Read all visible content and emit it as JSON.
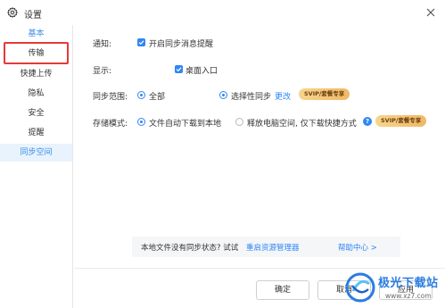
{
  "window": {
    "title": "设置",
    "title_icon": "gear-icon",
    "close_icon": "close-icon"
  },
  "sidebar": {
    "items": [
      {
        "label": "基本"
      },
      {
        "label": "传输"
      },
      {
        "label": "快捷上传"
      },
      {
        "label": "隐私"
      },
      {
        "label": "安全"
      },
      {
        "label": "提醒"
      },
      {
        "label": "同步空间"
      }
    ],
    "active_index": 6,
    "highlight_color": "#e23a3a"
  },
  "settings": {
    "notify": {
      "label": "通知:",
      "option": "开启同步消息提醒",
      "checked": true
    },
    "display": {
      "label": "显示:",
      "option": "桌面入口",
      "checked": true
    },
    "sync_range": {
      "label": "同步范围:",
      "options": [
        "全部",
        "选择性同步"
      ],
      "selected_index": 0,
      "change_link": "更改",
      "badge": "SVIP/套餐专享"
    },
    "storage_mode": {
      "label": "存储模式:",
      "options": [
        "文件自动下载到本地",
        "释放电脑空间, 仅下载快捷方式"
      ],
      "selected_index": 0,
      "help_icon": "help-icon",
      "badge": "SVIP/套餐专享"
    }
  },
  "notice": {
    "text": "本地文件没有同步状态? 试试",
    "link": "重启资源管理器",
    "help": "帮助中心 >"
  },
  "footer": {
    "ok": "确定",
    "cancel": "取消",
    "apply": "应用"
  },
  "watermark": {
    "name": "极光下载站",
    "url": "www.xz7.com"
  },
  "colors": {
    "accent": "#2f86f6",
    "sidebar_active_bg": "#e8f3fd",
    "badge_gold": "#efb865"
  }
}
